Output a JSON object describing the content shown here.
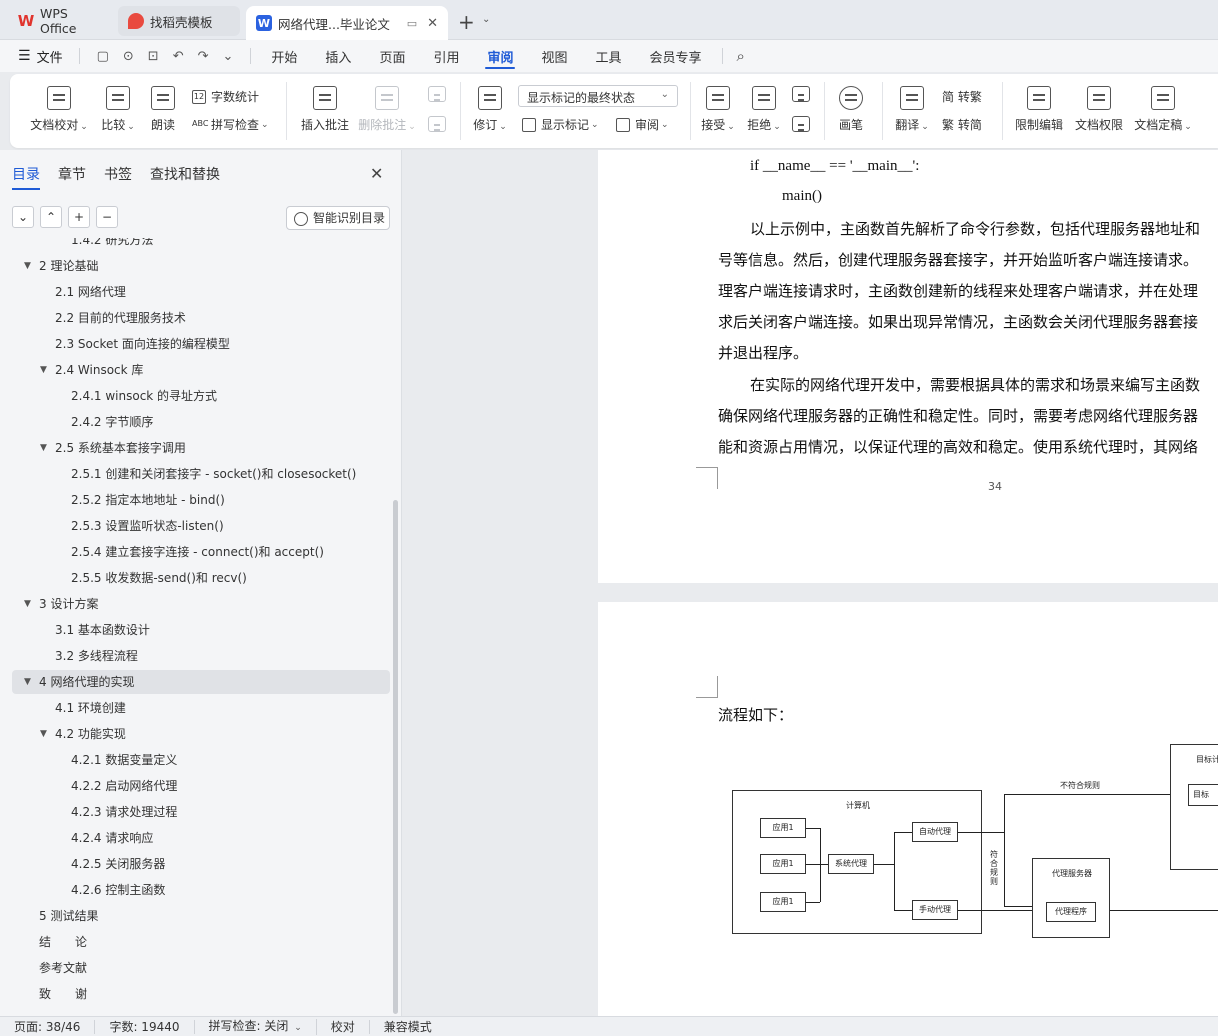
{
  "tabs": [
    {
      "label": "WPS Office"
    },
    {
      "label": "找稻壳模板"
    },
    {
      "label": "网络代理...毕业论文"
    }
  ],
  "menu": {
    "file": "文件",
    "items": [
      "开始",
      "插入",
      "页面",
      "引用",
      "审阅",
      "视图",
      "工具",
      "会员专享"
    ],
    "active": "审阅"
  },
  "ribbon": {
    "doc_check": "文档校对",
    "compare": "比较",
    "read_aloud": "朗读",
    "word_count": "字数统计",
    "spell_check": "拼写检查",
    "insert_comment": "插入批注",
    "delete_comment": "删除批注",
    "revise": "修订",
    "markup_state": "显示标记的最终状态",
    "show_markup": "显示标记",
    "review": "审阅",
    "accept": "接受",
    "reject": "拒绝",
    "pen": "画笔",
    "translate": "翻译",
    "to_traditional": "简 转繁",
    "to_simplified": "繁 转简",
    "restrict_edit": "限制编辑",
    "doc_permission": "文档权限",
    "doc_final": "文档定稿"
  },
  "nav": {
    "tabs": [
      "目录",
      "章节",
      "书签",
      "查找和替换"
    ],
    "smart_toc": "智能识别目录",
    "ctrl_down": "⌄",
    "ctrl_up": "⌃",
    "ctrl_add": "+",
    "ctrl_remove": "−",
    "toc": [
      {
        "text": "1.4.2 研究方法",
        "level": 3
      },
      {
        "text": "2 理论基础",
        "level": 1,
        "expanded": true
      },
      {
        "text": "2.1 网络代理",
        "level": 2
      },
      {
        "text": "2.2 目前的代理服务技术",
        "level": 2
      },
      {
        "text": "2.3 Socket 面向连接的编程模型",
        "level": 2
      },
      {
        "text": "2.4 Winsock 库",
        "level": 2,
        "expanded": true
      },
      {
        "text": "2.4.1 winsock 的寻址方式",
        "level": 3
      },
      {
        "text": "2.4.2 字节顺序",
        "level": 3
      },
      {
        "text": "2.5 系统基本套接字调用",
        "level": 2,
        "expanded": true
      },
      {
        "text": "2.5.1 创建和关闭套接字 - socket()和 closesocket()",
        "level": 3
      },
      {
        "text": "2.5.2 指定本地地址 - bind()",
        "level": 3
      },
      {
        "text": "2.5.3 设置监听状态-listen()",
        "level": 3
      },
      {
        "text": "2.5.4 建立套接字连接 - connect()和 accept()",
        "level": 3
      },
      {
        "text": "2.5.5 收发数据-send()和 recv()",
        "level": 3
      },
      {
        "text": "3 设计方案",
        "level": 1,
        "expanded": true
      },
      {
        "text": "3.1 基本函数设计",
        "level": 2
      },
      {
        "text": "3.2 多线程流程",
        "level": 2
      },
      {
        "text": "4 网络代理的实现",
        "level": 1,
        "expanded": true,
        "selected": true
      },
      {
        "text": "4.1 环境创建",
        "level": 2
      },
      {
        "text": "4.2 功能实现",
        "level": 2,
        "expanded": true
      },
      {
        "text": "4.2.1 数据变量定义",
        "level": 3
      },
      {
        "text": "4.2.2 启动网络代理",
        "level": 3
      },
      {
        "text": "4.2.3 请求处理过程",
        "level": 3
      },
      {
        "text": "4.2.4 请求响应",
        "level": 3
      },
      {
        "text": "4.2.5 关闭服务器",
        "level": 3
      },
      {
        "text": "4.2.6 控制主函数",
        "level": 3
      },
      {
        "text": "5 测试结果",
        "level": 1
      },
      {
        "text": "结　　论",
        "level": 1
      },
      {
        "text": "参考文献",
        "level": 1
      },
      {
        "text": "致　　谢",
        "level": 1
      }
    ]
  },
  "doc": {
    "code_line1": "if __name__ == '__main__':",
    "code_line2": "main()",
    "para1": [
      "以上示例中，主函数首先解析了命令行参数，包括代理服务器地址和",
      "号等信息。然后，创建代理服务器套接字，并开始监听客户端连接请求。",
      "理客户端连接请求时，主函数创建新的线程来处理客户端请求，并在处理",
      "求后关闭客户端连接。如果出现异常情况，主函数会关闭代理服务器套接",
      "并退出程序。"
    ],
    "para2": [
      "在实际的网络代理开发中，需要根据具体的需求和场景来编写主函数",
      "确保网络代理服务器的正确性和稳定性。同时，需要考虑网络代理服务器",
      "能和资源占用情况，以保证代理的高效和稳定。使用系统代理时，其网络"
    ],
    "page_number": "34",
    "flow_label": "流程如下：",
    "diagram": {
      "computer": "计算机",
      "app1": "应用1",
      "app2": "应用1",
      "app3": "应用1",
      "system_proxy": "系统代理",
      "auto_proxy": "自动代理",
      "manual_proxy": "手动代理",
      "not_match": "不符合规则",
      "match": "符合规则",
      "proxy_server": "代理服务器",
      "proxy_program": "代理程序",
      "target_computer": "目标计",
      "target": "目标"
    }
  },
  "status": {
    "page": "页面: 38/46",
    "words": "字数: 19440",
    "spell": "拼写检查: 关闭",
    "proof": "校对",
    "compat": "兼容模式"
  }
}
